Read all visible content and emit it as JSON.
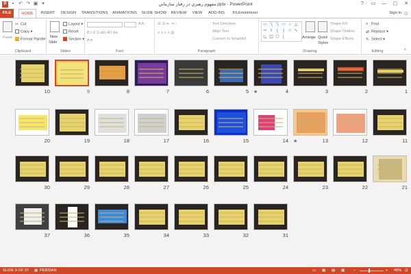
{
  "window": {
    "title": "مفهوم رهبري در رفتار سازماني.pptx - PowerPoint",
    "app_icon": "P",
    "controls": [
      "?",
      "▭",
      "—",
      "▢",
      "✕"
    ]
  },
  "tabs": {
    "items": [
      "FILE",
      "HOME",
      "INSERT",
      "DESIGN",
      "TRANSITIONS",
      "ANIMATIONS",
      "SLIDE SHOW",
      "REVIEW",
      "VIEW",
      "ADD-INS",
      "FILEminimizer"
    ],
    "active": "HOME",
    "sign_in": "Sign in"
  },
  "ribbon": {
    "clipboard": {
      "label": "Clipboard",
      "paste": "Paste",
      "cut": "Cut",
      "copy": "Copy",
      "format_painter": "Format Painter"
    },
    "slides": {
      "label": "Slides",
      "new_slide": "New",
      "new_slide_2": "Slide",
      "layout": "Layout",
      "reset": "Reset",
      "section": "Section"
    },
    "font": {
      "label": "Font"
    },
    "paragraph": {
      "label": "Paragraph",
      "text_direction": "Text Direction",
      "align_text": "Align Text",
      "convert_smartart": "Convert to SmartArt"
    },
    "drawing": {
      "label": "Drawing",
      "arrange": "Arrange",
      "quick_styles": "Quick",
      "quick_styles_2": "Styles",
      "shape_fill": "Shape Fill",
      "shape_outline": "Shape Outline",
      "shape_effects": "Shape Effects"
    },
    "editing": {
      "label": "Editing",
      "find": "Find",
      "replace": "Replace",
      "select": "Select"
    }
  },
  "slides": [
    {
      "n": "10"
    },
    {
      "n": "9"
    },
    {
      "n": "8"
    },
    {
      "n": "7"
    },
    {
      "n": "6"
    },
    {
      "n": "5"
    },
    {
      "n": "4"
    },
    {
      "n": "3"
    },
    {
      "n": "2"
    },
    {
      "n": "1"
    },
    {
      "n": "20"
    },
    {
      "n": "19"
    },
    {
      "n": "18"
    },
    {
      "n": "17"
    },
    {
      "n": "16"
    },
    {
      "n": "15"
    },
    {
      "n": "14"
    },
    {
      "n": "13"
    },
    {
      "n": "12"
    },
    {
      "n": "11"
    },
    {
      "n": "30"
    },
    {
      "n": "29"
    },
    {
      "n": "28"
    },
    {
      "n": "27"
    },
    {
      "n": "26"
    },
    {
      "n": "25"
    },
    {
      "n": "24"
    },
    {
      "n": "23"
    },
    {
      "n": "22"
    },
    {
      "n": "21"
    },
    {
      "n": "37"
    },
    {
      "n": "36"
    },
    {
      "n": "35"
    },
    {
      "n": "34"
    },
    {
      "n": "33"
    },
    {
      "n": "32"
    },
    {
      "n": "31"
    }
  ],
  "selected_slide": "9",
  "slide_text": {
    "s9": "",
    "s20_a": "انتظار",
    "s20_b": "محيط ورودي آن"
  },
  "status": {
    "slide_info": "SLIDE 9 OF 37",
    "language": "PERSIAN",
    "zoom": "40%"
  },
  "colors": {
    "accent": "#d24726",
    "slide_bg": "#3a322a",
    "slide_title": "#e3c94a"
  }
}
